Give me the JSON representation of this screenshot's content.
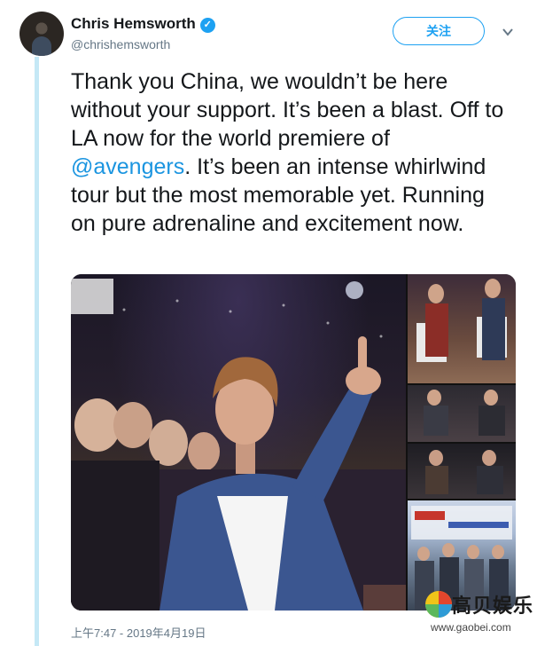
{
  "user": {
    "display_name": "Chris Hemsworth",
    "handle": "@chrishemsworth",
    "verified_icon": "verified-badge-icon"
  },
  "actions": {
    "follow_label": "关注",
    "more_icon": "chevron-down-icon"
  },
  "tweet": {
    "text_before": "Thank you China, we wouldn’t be here without your support. It’s been a blast. Off to LA now for the world premiere of ",
    "mention": "@avengers",
    "text_after": ". It’s been an intense whirlwind tour but the most memorable yet. Running on pure adrenaline and excitement now.",
    "timestamp": "上午7:47 - 2019年4月19日"
  },
  "watermark": {
    "name": "高贝娱乐",
    "url": "www.gaobei.com"
  },
  "colors": {
    "accent": "#1da1f2",
    "mention": "#1b95e0",
    "secondary_text": "#657786",
    "thread_line": "#c5e8f6"
  }
}
